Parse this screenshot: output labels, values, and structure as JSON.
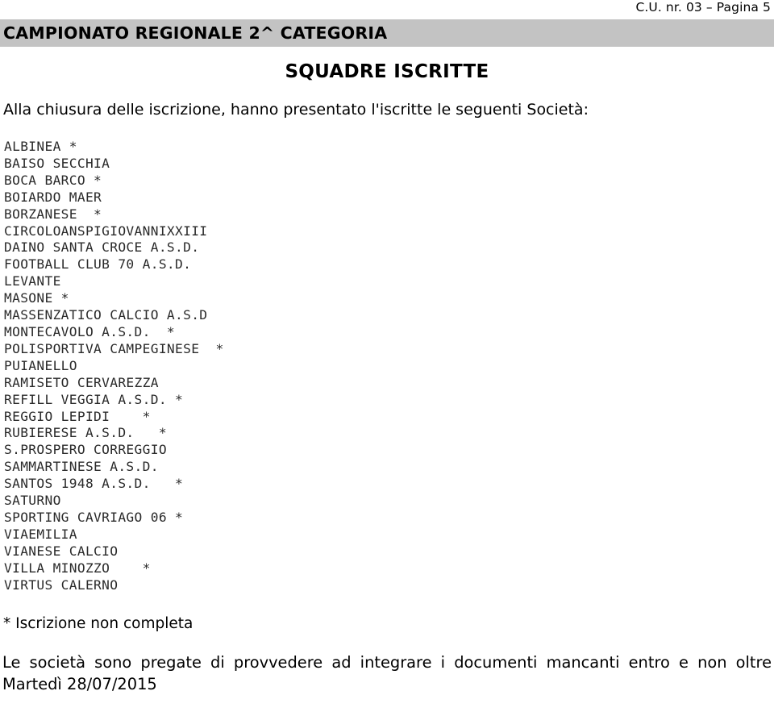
{
  "header": {
    "running_head": "C.U. nr. 03 – Pagina 5"
  },
  "title_band": {
    "title": "CAMPIONATO REGIONALE 2^ CATEGORIA",
    "background_color": "#c3c3c3"
  },
  "subtitle": {
    "text": "SQUADRE ISCRITTE"
  },
  "intro": {
    "text": "Alla chiusura delle iscrizione, hanno presentato l'iscritte le seguenti Società:"
  },
  "club_list": {
    "incomplete_marker": "*",
    "entries": [
      {
        "name": "ALBINEA",
        "line": "ALBINEA *",
        "incomplete": true
      },
      {
        "name": "BAISO SECCHIA",
        "line": "BAISO SECCHIA",
        "incomplete": false
      },
      {
        "name": "BOCA BARCO",
        "line": "BOCA BARCO *",
        "incomplete": true
      },
      {
        "name": "BOIARDO MAER",
        "line": "BOIARDO MAER",
        "incomplete": false
      },
      {
        "name": "BORZANESE",
        "line": "BORZANESE  *",
        "incomplete": true
      },
      {
        "name": "CIRCOLOANSPIGIOVANNIXXIII",
        "line": "CIRCOLOANSPIGIOVANNIXXIII",
        "incomplete": false
      },
      {
        "name": "DAINO SANTA CROCE A.S.D.",
        "line": "DAINO SANTA CROCE A.S.D.",
        "incomplete": false
      },
      {
        "name": "FOOTBALL CLUB 70 A.S.D.",
        "line": "FOOTBALL CLUB 70 A.S.D.",
        "incomplete": false
      },
      {
        "name": "LEVANTE",
        "line": "LEVANTE",
        "incomplete": false
      },
      {
        "name": "MASONE",
        "line": "MASONE *",
        "incomplete": true
      },
      {
        "name": "MASSENZATICO CALCIO A.S.D",
        "line": "MASSENZATICO CALCIO A.S.D",
        "incomplete": false
      },
      {
        "name": "MONTECAVOLO A.S.D.",
        "line": "MONTECAVOLO A.S.D.  *",
        "incomplete": true
      },
      {
        "name": "POLISPORTIVA CAMPEGINESE",
        "line": "POLISPORTIVA CAMPEGINESE  *",
        "incomplete": true
      },
      {
        "name": "PUIANELLO",
        "line": "PUIANELLO",
        "incomplete": false
      },
      {
        "name": "RAMISETO CERVAREZZA",
        "line": "RAMISETO CERVAREZZA",
        "incomplete": false
      },
      {
        "name": "REFILL VEGGIA A.S.D.",
        "line": "REFILL VEGGIA A.S.D. *",
        "incomplete": true
      },
      {
        "name": "REGGIO LEPIDI",
        "line": "REGGIO LEPIDI    *",
        "incomplete": true
      },
      {
        "name": "RUBIERESE A.S.D.",
        "line": "RUBIERESE A.S.D.   *",
        "incomplete": true
      },
      {
        "name": "S.PROSPERO CORREGGIO",
        "line": "S.PROSPERO CORREGGIO",
        "incomplete": false
      },
      {
        "name": "SAMMARTINESE A.S.D.",
        "line": "SAMMARTINESE A.S.D.",
        "incomplete": false
      },
      {
        "name": "SANTOS 1948 A.S.D.",
        "line": "SANTOS 1948 A.S.D.   *",
        "incomplete": true
      },
      {
        "name": "SATURNO",
        "line": "SATURNO",
        "incomplete": false
      },
      {
        "name": "SPORTING CAVRIAGO 06",
        "line": "SPORTING CAVRIAGO 06 *",
        "incomplete": true
      },
      {
        "name": "VIAEMILIA",
        "line": "VIAEMILIA",
        "incomplete": false
      },
      {
        "name": "VIANESE CALCIO",
        "line": "VIANESE CALCIO",
        "incomplete": false
      },
      {
        "name": "VILLA MINOZZO",
        "line": "VILLA MINOZZO    *",
        "incomplete": true
      },
      {
        "name": "VIRTUS CALERNO",
        "line": "VIRTUS CALERNO",
        "incomplete": false
      }
    ]
  },
  "legend": {
    "text": "* Iscrizione non completa"
  },
  "closing": {
    "text": "Le società sono pregate di provvedere ad integrare i documenti mancanti entro e non oltre Martedì 28/07/2015"
  }
}
